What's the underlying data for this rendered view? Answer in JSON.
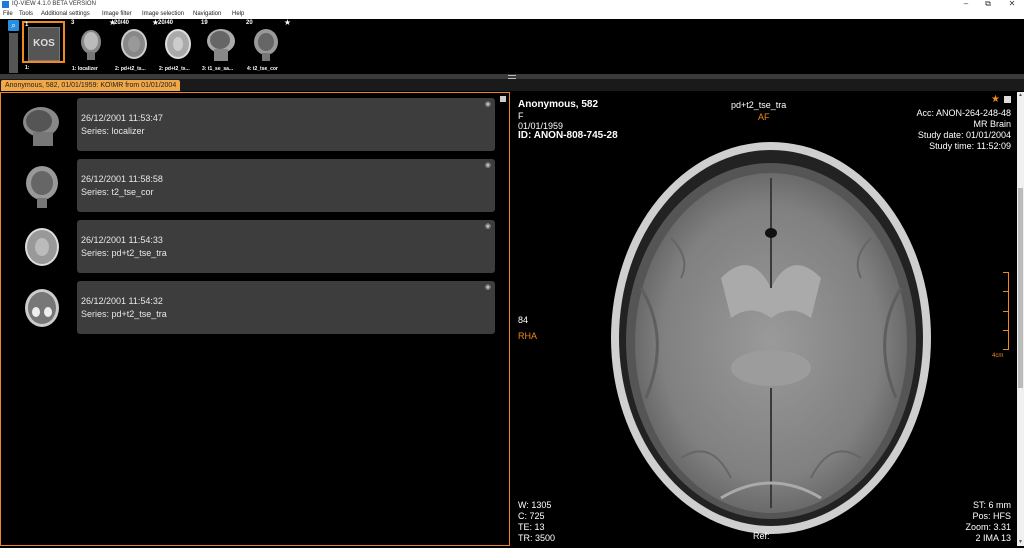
{
  "window": {
    "title": "IQ-VIEW 4.1.0 BETA VERSION"
  },
  "menu": [
    "File",
    "Tools",
    "Additional settings",
    "Image filter",
    "Image selection",
    "Navigation",
    "Help"
  ],
  "thumbnails": [
    {
      "count": "1",
      "label": "1:",
      "kos_text": "KOS",
      "star": ""
    },
    {
      "count": "3",
      "label": "1: localizer",
      "star": "★"
    },
    {
      "count": "20/40",
      "label": "2: pd+t2_ts...",
      "star": "★"
    },
    {
      "count": "20/40",
      "label": "2: pd+t2_ts...",
      "star": ""
    },
    {
      "count": "19",
      "label": "3: t1_se_sa...",
      "star": ""
    },
    {
      "count": "20",
      "label": "4: t2_tse_cor",
      "star": "★"
    }
  ],
  "tab": {
    "label": "Anonymous, 582, 01/01/1959: KO\\MR from 01/01/2004"
  },
  "series": [
    {
      "date": "26/12/2001 11:53:47",
      "series": "Series: localizer"
    },
    {
      "date": "26/12/2001 11:58:58",
      "series": "Series: t2_tse_cor"
    },
    {
      "date": "26/12/2001 11:54:33",
      "series": "Series: pd+t2_tse_tra"
    },
    {
      "date": "26/12/2001 11:54:32",
      "series": "Series: pd+t2_tse_tra"
    }
  ],
  "viewer": {
    "patient_name": "Anonymous, 582",
    "sex": "F",
    "dob": "01/01/1959",
    "id": "ID: ANON-808-745-28",
    "series_name": "pd+t2_tse_tra",
    "orient_top": "AF",
    "acc": "Acc: ANON-264-248-48",
    "study_desc": "MR Brain",
    "study_date": "Study date: 01/01/2004",
    "study_time": "Study time: 11:52:09",
    "left_num": "84",
    "orient_left": "RHA",
    "ruler_label": "4cm",
    "window_w": "W: 1305",
    "window_c": "C: 725",
    "te": "TE: 13",
    "tr": "TR: 3500",
    "ref": "Ref:",
    "st": "ST: 6 mm",
    "pos": "Pos: HFS",
    "zoom": "Zoom: 3.31",
    "ima": "2 IMA 13",
    "star_icon": "★"
  }
}
